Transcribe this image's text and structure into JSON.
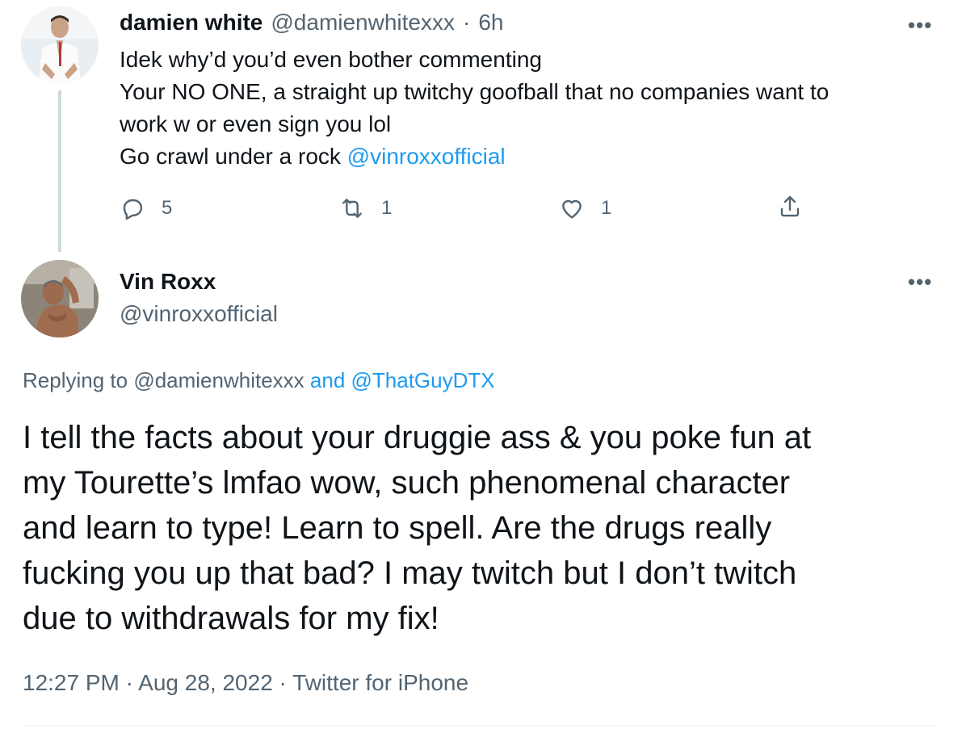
{
  "parent_tweet": {
    "display_name": "damien white",
    "handle": "@damienwhitexxx",
    "separator": "·",
    "time": "6h",
    "lines": [
      "Idek why’d you’d even bother commenting",
      "Your NO ONE, a straight up twitchy goofball that no companies want to",
      "work w or even sign you lol"
    ],
    "last_line_prefix": "Go crawl under a rock ",
    "last_line_mention": "@vinroxxofficial",
    "more_icon": "more-dots-icon",
    "actions": {
      "replies": "5",
      "retweets": "1",
      "likes": "1"
    }
  },
  "main_tweet": {
    "display_name": "Vin Roxx",
    "handle": "@vinroxxofficial",
    "replying_prefix": "Replying to ",
    "replying_to_1": "@damienwhitexxx",
    "replying_and": " and ",
    "replying_to_2": "@ThatGuyDTX",
    "text_lines": [
      "I tell the facts about your druggie ass & you poke fun at",
      "my Tourette’s lmfao wow, such phenomenal character",
      "and learn to type! Learn to spell. Are the drugs really",
      "fucking you up that bad? I may twitch but I don’t twitch",
      "due to withdrawals for my fix!"
    ],
    "timestamp": "12:27 PM · Aug 28, 2022 · Twitter for iPhone"
  },
  "colors": {
    "text": "#0f1419",
    "secondary": "#536471",
    "link": "#1d9bf0",
    "thread_line": "#cfd9de"
  }
}
